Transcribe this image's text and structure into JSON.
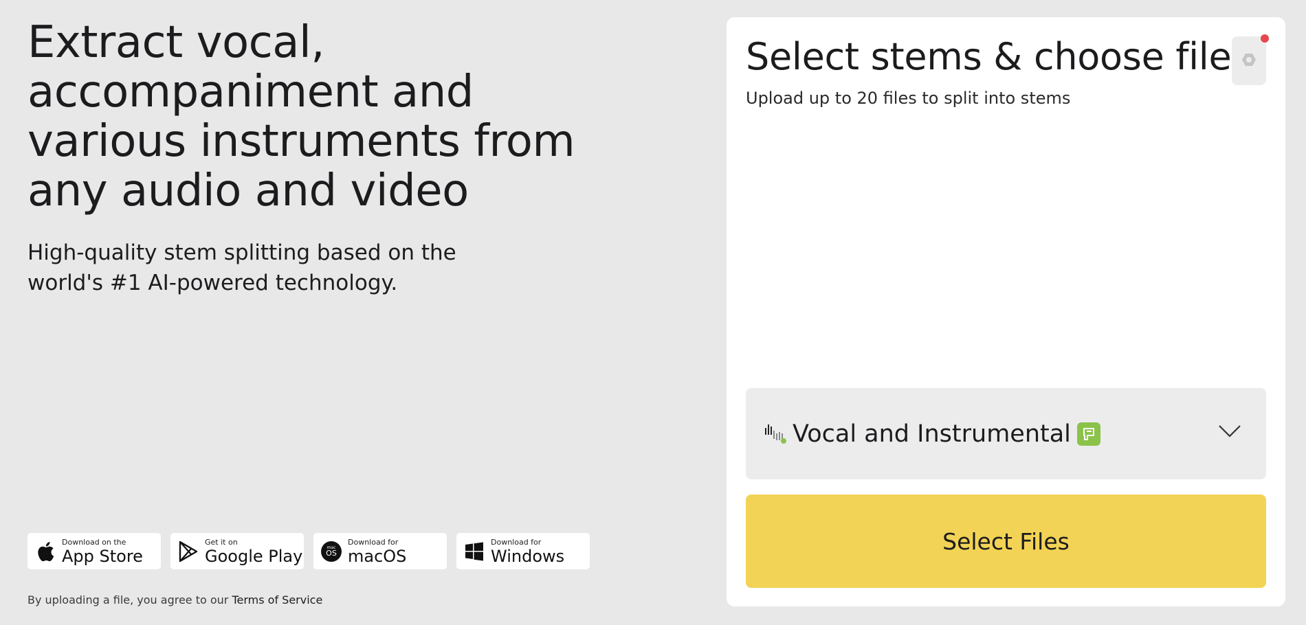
{
  "hero": {
    "title": "Extract vocal, accompaniment and various instruments from any audio and video",
    "subtitle": "High-quality stem splitting based on the world's #1 AI-powered technology."
  },
  "badges": [
    {
      "small": "Download on the",
      "big": "App Store",
      "icon": "apple-icon"
    },
    {
      "small": "Get it on",
      "big": "Google Play",
      "icon": "google-play-icon"
    },
    {
      "small": "Download for",
      "big": "macOS",
      "icon": "macos-icon",
      "icon_text": "OS",
      "icon_caption": "mac"
    },
    {
      "small": "Download for",
      "big": "Windows",
      "icon": "windows-icon"
    }
  ],
  "terms": {
    "prefix": "By uploading a file, you agree to our ",
    "link": "Terms of Service"
  },
  "panel": {
    "title": "Select stems & choose files",
    "subtitle": "Upload up to 20 files to split into stems",
    "settings_icon": "gear-icon",
    "notification_color": "#e5484d",
    "stem_select": {
      "value": "Vocal and Instrumental",
      "icon": "stems-waveform-icon",
      "badge_icon": "premium-flag-icon",
      "badge_color": "#8bc34a"
    },
    "select_button": "Select Files",
    "button_color": "#f2d355"
  }
}
